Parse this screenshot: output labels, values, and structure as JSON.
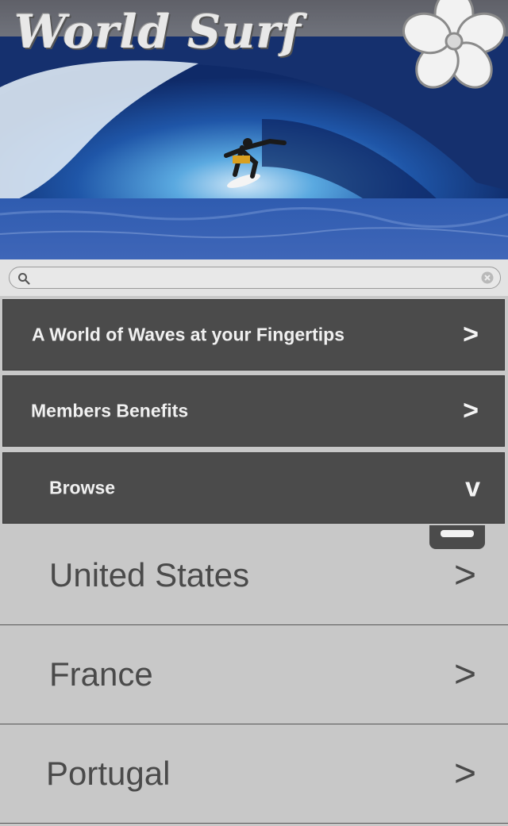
{
  "app": {
    "logo_text": "World Surf"
  },
  "search": {
    "placeholder": "",
    "value": ""
  },
  "nav": [
    {
      "label": "A World of Waves at your Fingertips",
      "chevron": ">"
    },
    {
      "label": "Members Benefits",
      "chevron": ">"
    },
    {
      "label": "Browse",
      "chevron": "v"
    }
  ],
  "countries": [
    {
      "name": "United States",
      "chevron": ">"
    },
    {
      "name": "France",
      "chevron": ">"
    },
    {
      "name": "Portugal",
      "chevron": ">"
    }
  ],
  "colors": {
    "nav_bg": "#4b4b4b",
    "list_bg": "#c8c8c8",
    "search_bg": "#e3e3e3",
    "wave_blue": "#1d3880"
  },
  "icons": [
    "search-icon",
    "clear-icon",
    "hibiscus-icon",
    "chevron-right-icon",
    "chevron-down-icon"
  ]
}
